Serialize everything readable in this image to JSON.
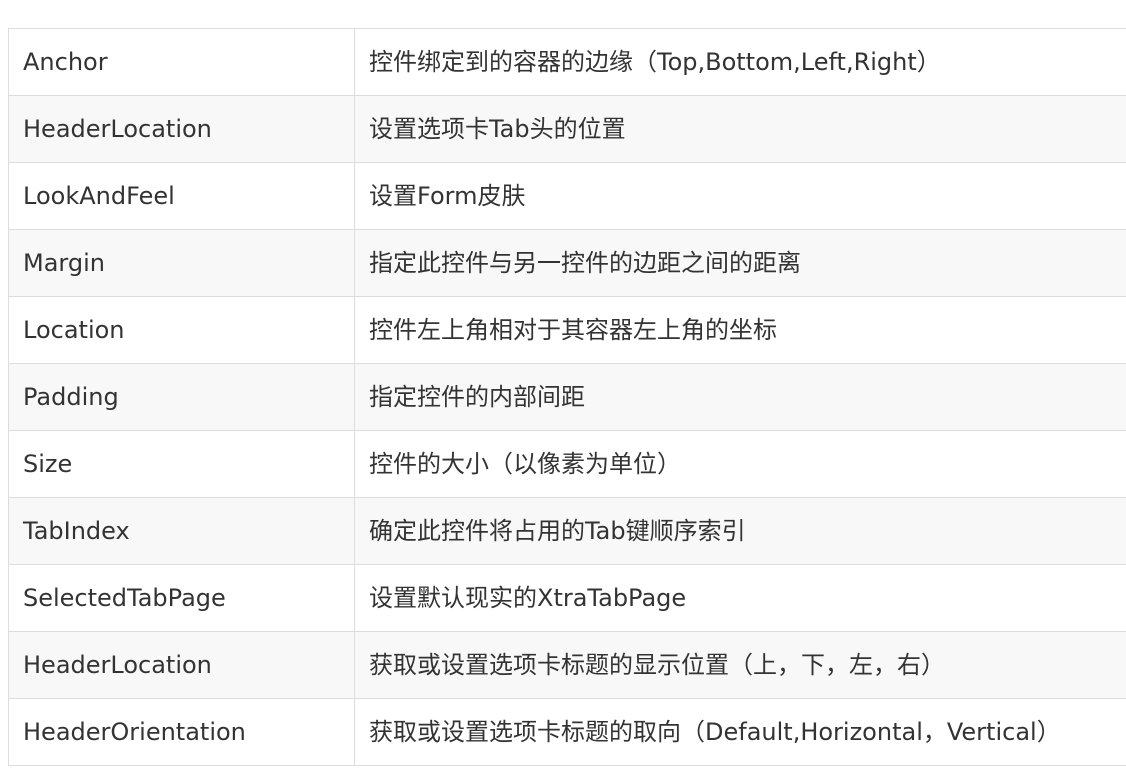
{
  "table": {
    "rows": [
      {
        "name": "Anchor",
        "description": "控件绑定到的容器的边缘（Top,Bottom,Left,Right）"
      },
      {
        "name": "HeaderLocation",
        "description": "设置选项卡Tab头的位置"
      },
      {
        "name": "LookAndFeel",
        "description": "设置Form皮肤"
      },
      {
        "name": "Margin",
        "description": "指定此控件与另一控件的边距之间的距离"
      },
      {
        "name": "Location",
        "description": "控件左上角相对于其容器左上角的坐标"
      },
      {
        "name": "Padding",
        "description": "指定控件的内部间距"
      },
      {
        "name": "Size",
        "description": "控件的大小（以像素为单位）"
      },
      {
        "name": "TabIndex",
        "description": "确定此控件将占用的Tab键顺序索引"
      },
      {
        "name": "SelectedTabPage",
        "description": "设置默认现实的XtraTabPage"
      },
      {
        "name": "HeaderLocation",
        "description": "获取或设置选项卡标题的显示位置（上，下，左，右）"
      },
      {
        "name": "HeaderOrientation",
        "description": "获取或设置选项卡标题的取向（Default,Horizontal，Vertical）"
      }
    ]
  }
}
